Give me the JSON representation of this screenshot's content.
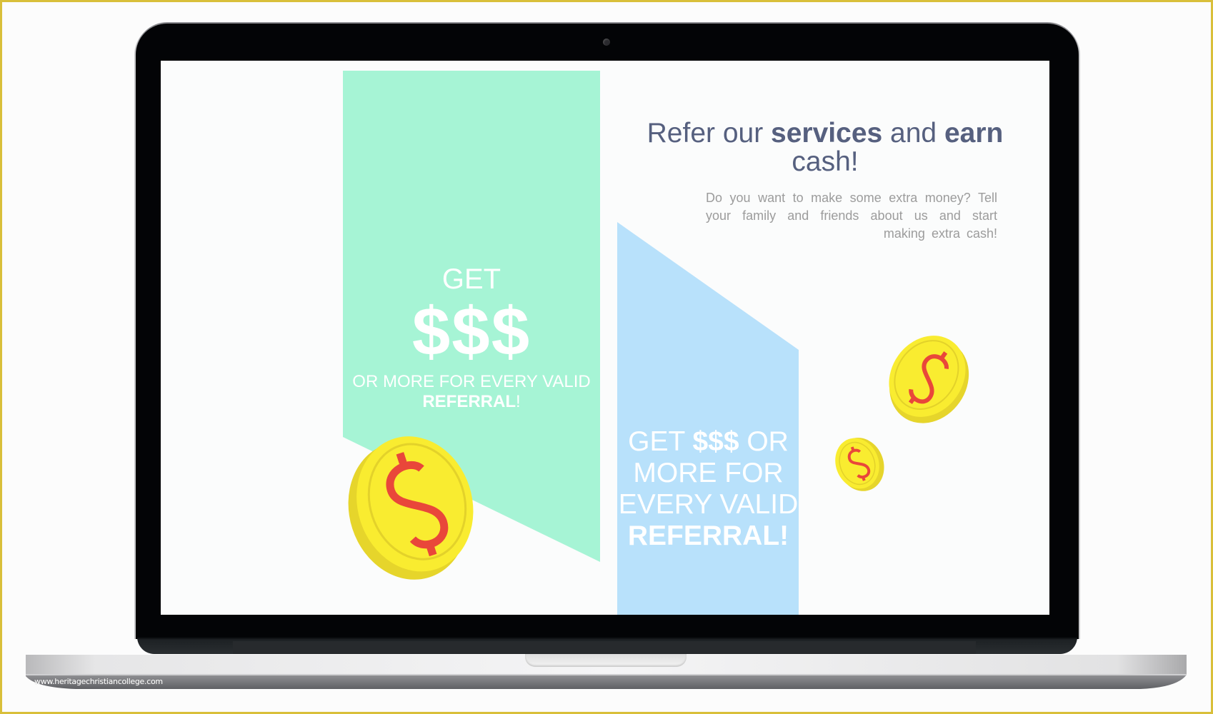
{
  "scene": {
    "device": "laptop",
    "watermark": "www.heritagechristiancollege.com"
  },
  "screen": {
    "headline": {
      "part1": "Refer our ",
      "bold1": "services",
      "part2": " and ",
      "bold2": "earn",
      "part3": " cash!"
    },
    "paragraph": "Do you want to make some extra money? Tell your family and friends about us and start making extra cash!",
    "mint_banner": {
      "get": "GET",
      "dollars": "$$$",
      "line": "OR MORE FOR EVERY VALID",
      "referral": "REFERRAL",
      "exclaim": "!"
    },
    "blue_banner": {
      "get": "GET ",
      "dollars": "$$$",
      "rest": " OR MORE FOR EVERY VALID ",
      "referral": "REFERRAL!"
    },
    "coins": [
      {
        "name": "large-coin",
        "symbol": "$"
      },
      {
        "name": "medium-coin",
        "symbol": "$"
      },
      {
        "name": "small-coin",
        "symbol": "$"
      }
    ]
  },
  "colors": {
    "frame_border": "#d9bf3a",
    "mint": "#a6f4d5",
    "sky_blue": "#b8e1fb",
    "coin_yellow": "#f9ec30",
    "coin_edge": "#e6d52b",
    "dollar_red": "#e9473a",
    "headline": "#56607f",
    "paragraph": "#9c9c9c"
  }
}
